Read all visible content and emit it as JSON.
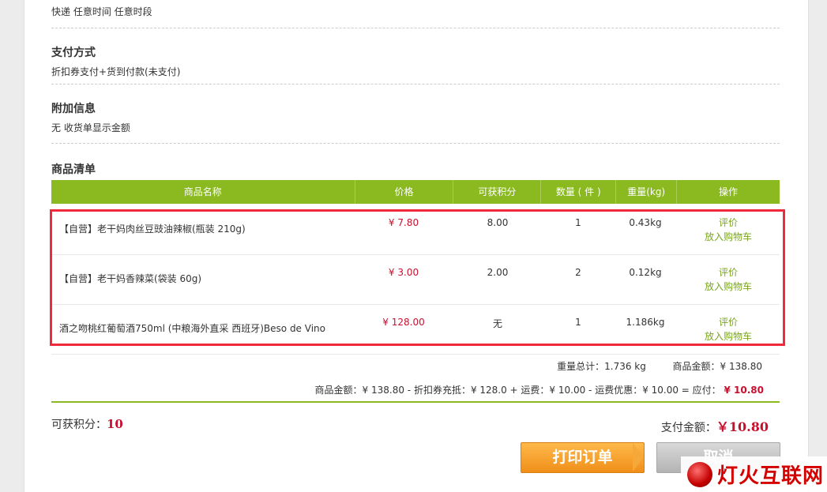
{
  "delivery": {
    "text": "快递 任意时间 任意时段"
  },
  "payment": {
    "title": "支付方式",
    "text": "折扣券支付+货到付款(未支付)"
  },
  "extra": {
    "title": "附加信息",
    "text": "无 收货单显示金额"
  },
  "items": {
    "title": "商品清单",
    "columns": [
      "商品名称",
      "价格",
      "可获积分",
      "数量 ( 件 )",
      "重量(kg)",
      "操作"
    ],
    "rows": [
      {
        "name": "【自营】老干妈肉丝豆豉油辣椒(瓶装 210g)",
        "price": "¥ 7.80",
        "points": "8.00",
        "qty": "1",
        "weight": "0.43kg",
        "op1": "评价",
        "op2": "放入购物车"
      },
      {
        "name": "【自营】老干妈香辣菜(袋装 60g)",
        "price": "¥ 3.00",
        "points": "2.00",
        "qty": "2",
        "weight": "0.12kg",
        "op1": "评价",
        "op2": "放入购物车"
      },
      {
        "name": "酒之吻桃红葡萄酒750ml (中粮海外直采 西班牙)Beso de Vino",
        "price": "¥ 128.00",
        "points": "无",
        "qty": "1",
        "weight": "1.186kg",
        "op1": "评价",
        "op2": "放入购物车"
      }
    ]
  },
  "summary": {
    "weight_total": "重量总计：1.736 kg",
    "goods_amount": "商品金额：¥ 138.80",
    "formula": "商品金额：¥ 138.80 - 折扣券充抵：¥ 128.0 + 运费：¥ 10.00 - 运费优惠：¥ 10.00 = 应付：",
    "payable": "¥ 10.80"
  },
  "points": {
    "label": "可获积分：",
    "value": "10"
  },
  "pay_total": {
    "label": "支付金额：",
    "value": "￥10.80"
  },
  "buttons": {
    "print": "打印订单",
    "cancel": "取消"
  },
  "watermark": {
    "text": "灯火互联网"
  },
  "colors": {
    "accent_green": "#8ab920",
    "price_red": "#c8102e",
    "highlight_red": "#f02a3c",
    "print_orange": "#f08f1a"
  }
}
